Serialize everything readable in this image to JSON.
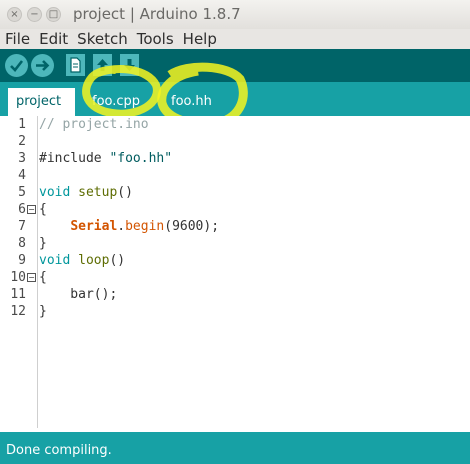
{
  "window": {
    "title": "project | Arduino 1.8.7",
    "controls": [
      "×",
      "−",
      "□"
    ]
  },
  "menu": [
    "File",
    "Edit",
    "Sketch",
    "Tools",
    "Help"
  ],
  "toolbar": {
    "buttons": [
      "verify-icon",
      "upload-icon",
      "new-icon",
      "open-icon",
      "save-icon"
    ]
  },
  "tabs": [
    {
      "label": "project",
      "active": true
    },
    {
      "label": "foo.cpp",
      "active": false
    },
    {
      "label": "foo.hh",
      "active": false
    }
  ],
  "editor": {
    "line_numbers": [
      "1",
      "2",
      "3",
      "4",
      "5",
      "6",
      "7",
      "8",
      "9",
      "10",
      "11",
      "12"
    ],
    "lines": [
      {
        "parts": [
          {
            "t": "// project.ino",
            "c": "comment"
          }
        ]
      },
      {
        "parts": []
      },
      {
        "parts": [
          {
            "t": "#include ",
            "c": ""
          },
          {
            "t": "\"foo.hh\"",
            "c": "str"
          }
        ]
      },
      {
        "parts": []
      },
      {
        "parts": [
          {
            "t": "void",
            "c": "type"
          },
          {
            "t": " ",
            "c": ""
          },
          {
            "t": "setup",
            "c": "kw"
          },
          {
            "t": "()",
            "c": ""
          }
        ]
      },
      {
        "parts": [
          {
            "t": "{",
            "c": ""
          }
        ]
      },
      {
        "parts": [
          {
            "t": "    ",
            "c": ""
          },
          {
            "t": "Serial",
            "c": "classname"
          },
          {
            "t": ".",
            "c": ""
          },
          {
            "t": "begin",
            "c": "func"
          },
          {
            "t": "(9600);",
            "c": ""
          }
        ]
      },
      {
        "parts": [
          {
            "t": "}",
            "c": ""
          }
        ]
      },
      {
        "parts": [
          {
            "t": "void",
            "c": "type"
          },
          {
            "t": " ",
            "c": ""
          },
          {
            "t": "loop",
            "c": "kw"
          },
          {
            "t": "()",
            "c": ""
          }
        ]
      },
      {
        "parts": [
          {
            "t": "{",
            "c": ""
          }
        ]
      },
      {
        "parts": [
          {
            "t": "    bar();",
            "c": ""
          }
        ]
      },
      {
        "parts": [
          {
            "t": "}",
            "c": ""
          }
        ]
      }
    ],
    "fold_lines": [
      6,
      10
    ]
  },
  "status": {
    "message": "Done compiling."
  },
  "colors": {
    "toolbar_bg": "#006468",
    "tab_bar_bg": "#17a1a5",
    "button_bg": "#4db7bb",
    "highlight": "#f4f520"
  }
}
